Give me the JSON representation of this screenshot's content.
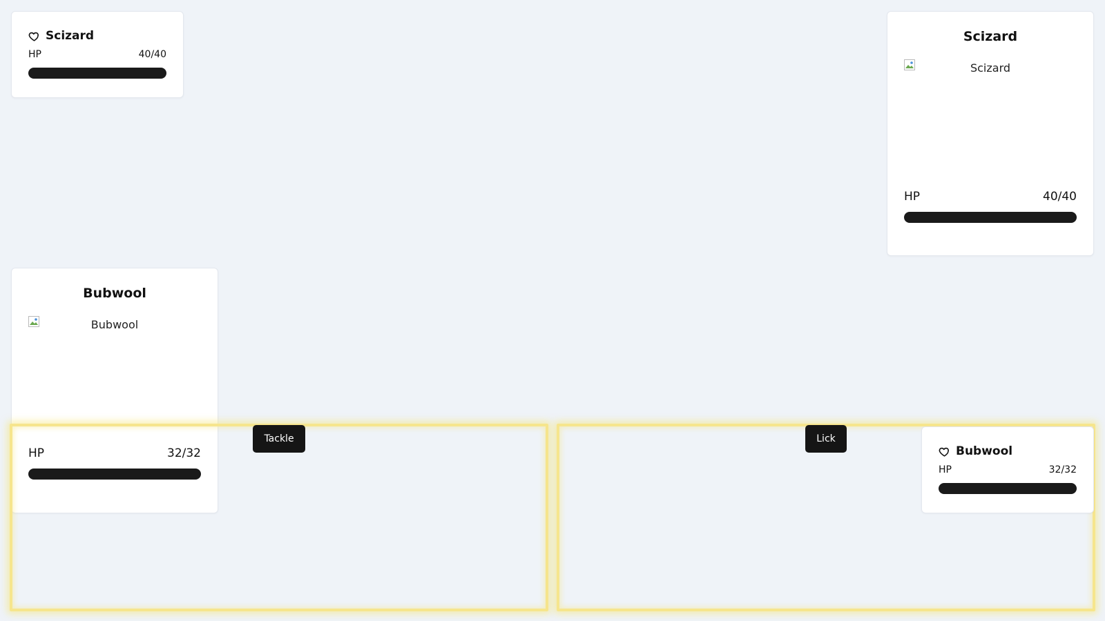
{
  "opponent_status": {
    "name": "Scizard",
    "hp_label": "HP",
    "hp_text": "40/40",
    "hp_fraction": 1.0
  },
  "opponent_card": {
    "name": "Scizard",
    "sprite_alt": "Scizard",
    "hp_label": "HP",
    "hp_text": "40/40",
    "hp_fraction": 1.0
  },
  "player_card": {
    "name": "Bubwool",
    "sprite_alt": "Bubwool",
    "hp_label": "HP",
    "hp_text": "32/32",
    "hp_fraction": 1.0
  },
  "player_status": {
    "name": "Bubwool",
    "hp_label": "HP",
    "hp_text": "32/32",
    "hp_fraction": 1.0
  },
  "moves": [
    {
      "label": "Tackle"
    },
    {
      "label": "Lick"
    }
  ],
  "colors": {
    "background": "#eff3f8",
    "bar": "#1a1a1a",
    "zone_glow": "#f6e58d",
    "button": "#151515"
  },
  "icons": {
    "status": "heart-icon",
    "sprite": "broken-image-icon"
  }
}
